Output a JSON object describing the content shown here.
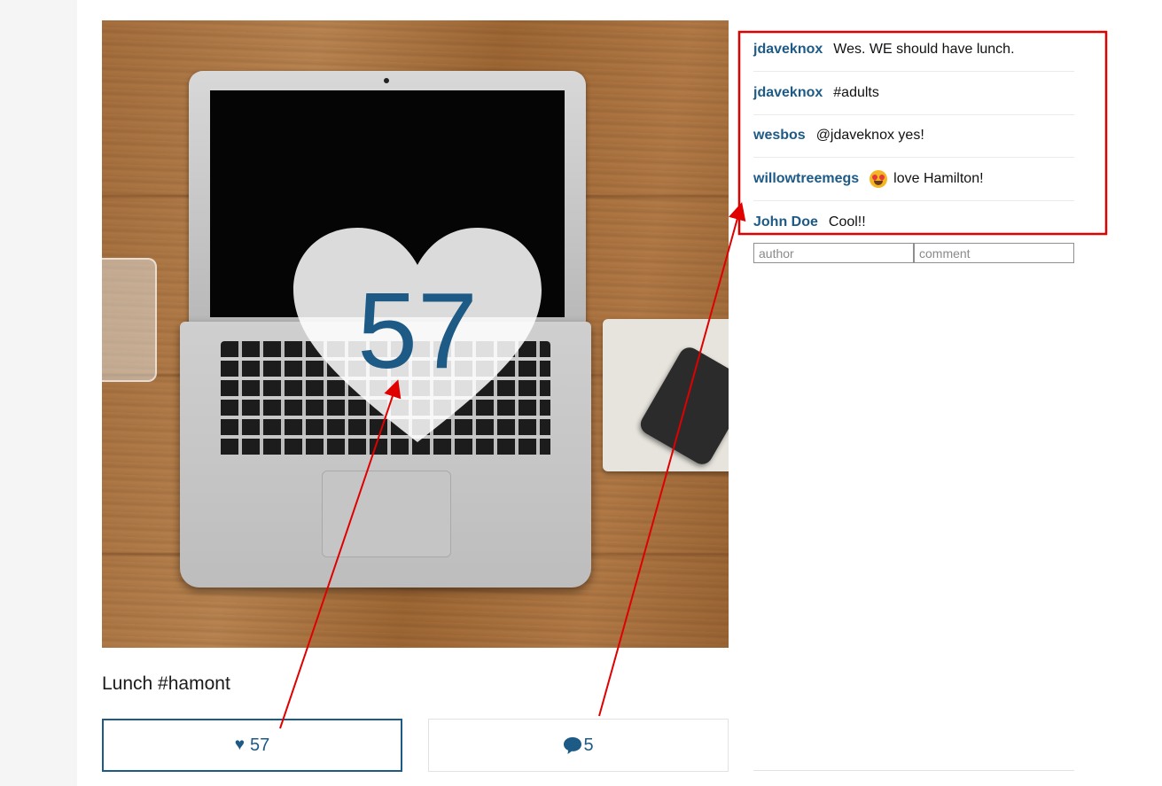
{
  "post": {
    "photo_alt": "Laptop on wooden table",
    "likes_overlay": "57",
    "caption": "Lunch #hamont",
    "like_button": {
      "icon": "♥",
      "count": "57"
    },
    "comments_button": {
      "icon": "speech-bubble-icon",
      "count": "5"
    }
  },
  "comments": [
    {
      "author": "jdaveknox",
      "text": "Wes. WE should have lunch."
    },
    {
      "author": "jdaveknox",
      "text": "#adults"
    },
    {
      "author": "wesbos",
      "text": "@jdaveknox yes!"
    },
    {
      "author": "willowtreemegs",
      "text": "love Hamilton!",
      "emoji": "heart-eyes-emoji"
    },
    {
      "author": "John Doe",
      "text": "Cool!!"
    }
  ],
  "comment_form": {
    "author_placeholder": "author",
    "comment_placeholder": "comment"
  },
  "colors": {
    "accent": "#1d5a86",
    "annotation": "#e00000"
  }
}
